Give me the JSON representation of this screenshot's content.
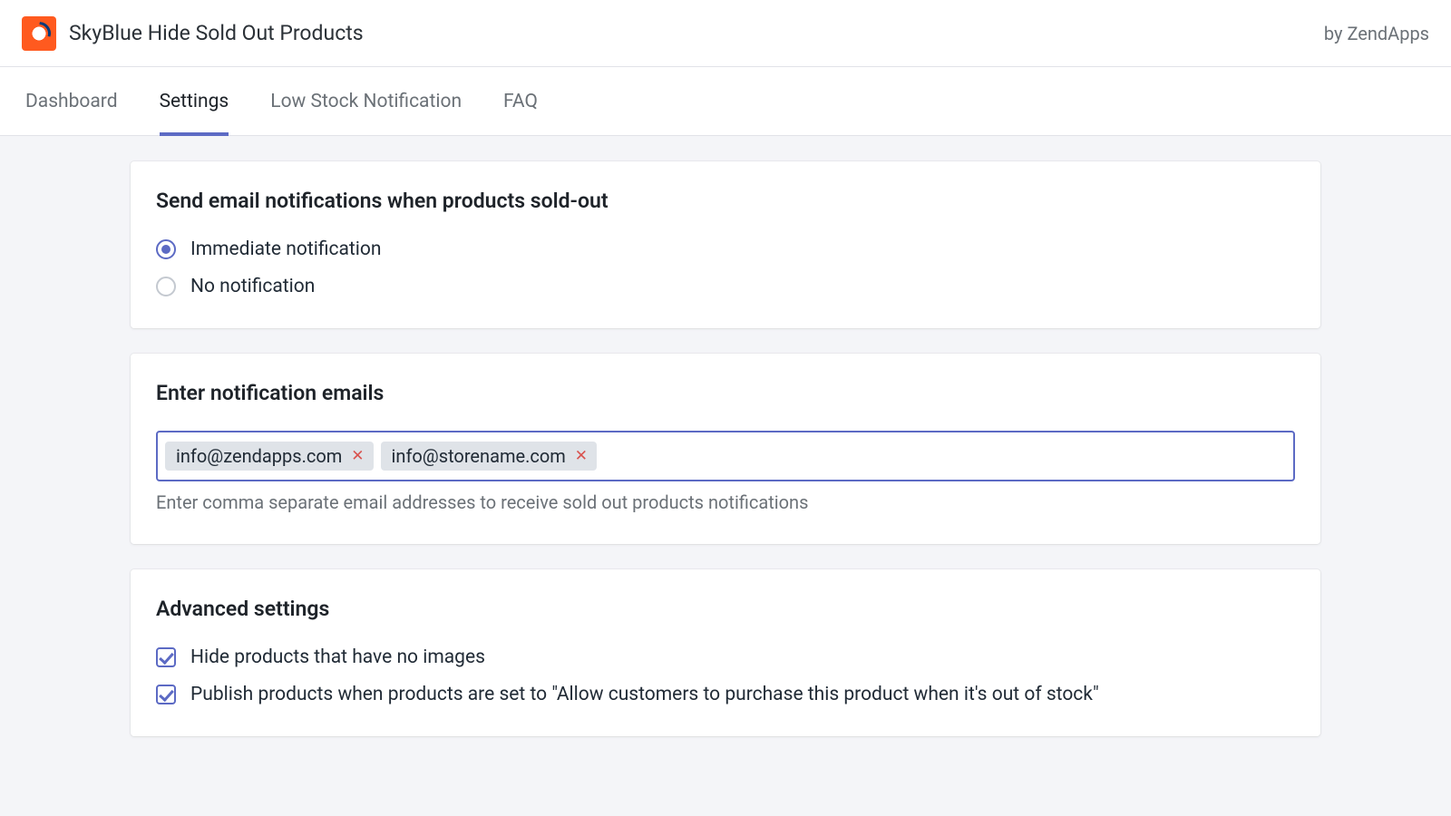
{
  "header": {
    "title": "SkyBlue Hide Sold Out Products",
    "vendor": "by ZendApps"
  },
  "tabs": [
    {
      "label": "Dashboard",
      "active": false
    },
    {
      "label": "Settings",
      "active": true
    },
    {
      "label": "Low Stock Notification",
      "active": false
    },
    {
      "label": "FAQ",
      "active": false
    }
  ],
  "notify_card": {
    "title": "Send email notifications when products sold-out",
    "options": [
      {
        "label": "Immediate notification",
        "checked": true
      },
      {
        "label": "No notification",
        "checked": false
      }
    ]
  },
  "emails_card": {
    "title": "Enter notification emails",
    "tags": [
      "info@zendapps.com",
      "info@storename.com"
    ],
    "help": "Enter comma separate email addresses to receive sold out products notifications"
  },
  "advanced_card": {
    "title": "Advanced settings",
    "options": [
      {
        "label": "Hide products that have no images",
        "checked": true
      },
      {
        "label": "Publish products when products are set to \"Allow customers to purchase this product when it's out of stock\"",
        "checked": true
      }
    ]
  }
}
